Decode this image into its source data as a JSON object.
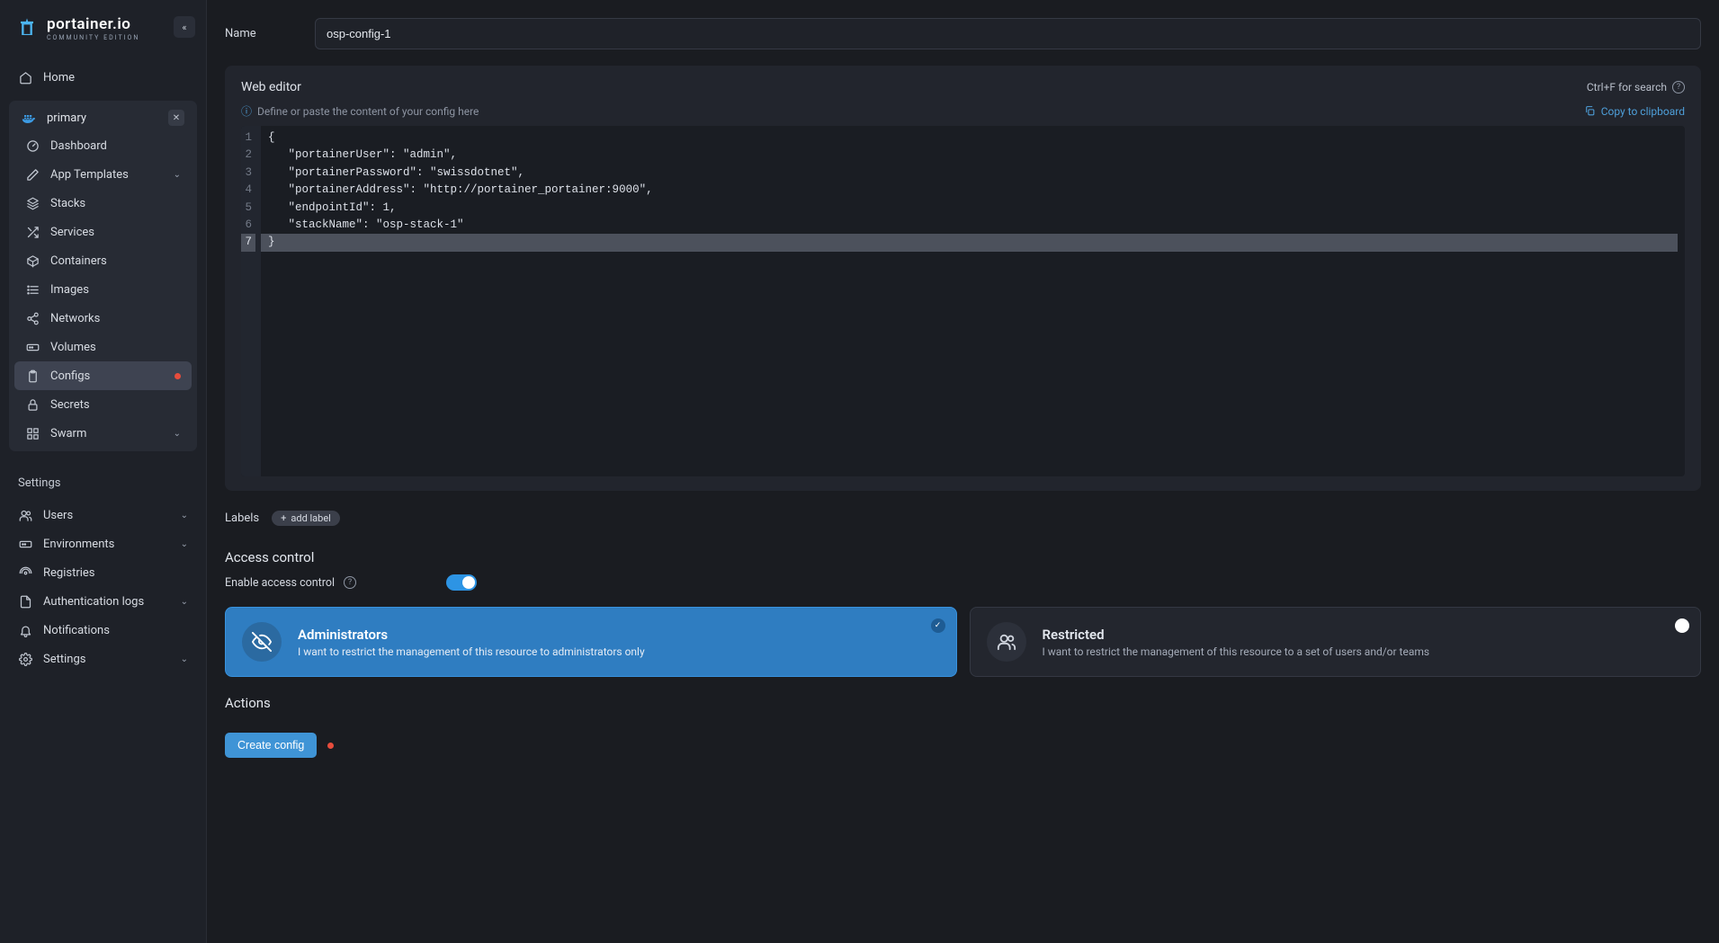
{
  "brand": {
    "name": "portainer.io",
    "edition": "COMMUNITY EDITION"
  },
  "sidebar": {
    "home": "Home",
    "env_name": "primary",
    "items": [
      {
        "label": "Dashboard",
        "icon": "gauge"
      },
      {
        "label": "App Templates",
        "icon": "edit",
        "chevron": true
      },
      {
        "label": "Stacks",
        "icon": "layers"
      },
      {
        "label": "Services",
        "icon": "shuffle"
      },
      {
        "label": "Containers",
        "icon": "box"
      },
      {
        "label": "Images",
        "icon": "list"
      },
      {
        "label": "Networks",
        "icon": "share"
      },
      {
        "label": "Volumes",
        "icon": "hdd"
      },
      {
        "label": "Configs",
        "icon": "clipboard",
        "active": true,
        "dot": true
      },
      {
        "label": "Secrets",
        "icon": "lock"
      },
      {
        "label": "Swarm",
        "icon": "grid3",
        "chevron": true
      }
    ],
    "settings_label": "Settings",
    "settings": [
      {
        "label": "Users",
        "icon": "users",
        "chevron": true
      },
      {
        "label": "Environments",
        "icon": "hdd",
        "chevron": true
      },
      {
        "label": "Registries",
        "icon": "radio"
      },
      {
        "label": "Authentication logs",
        "icon": "file",
        "chevron": true
      },
      {
        "label": "Notifications",
        "icon": "bell"
      },
      {
        "label": "Settings",
        "icon": "gear",
        "chevron": true
      }
    ]
  },
  "form": {
    "name_label": "Name",
    "name_value": "osp-config-1"
  },
  "editor": {
    "title": "Web editor",
    "search_hint": "Ctrl+F for search",
    "hint": "Define or paste the content of your config here",
    "copy": "Copy to clipboard",
    "lines": [
      "{",
      "   \"portainerUser\": \"admin\",",
      "   \"portainerPassword\": \"swissdotnet\",",
      "   \"portainerAddress\": \"http://portainer_portainer:9000\",",
      "   \"endpointId\": 1,",
      "   \"stackName\": \"osp-stack-1\"",
      "}"
    ],
    "current_line_index": 6
  },
  "labels": {
    "label": "Labels",
    "add": "add label"
  },
  "access": {
    "title": "Access control",
    "enable_label": "Enable access control",
    "cards": [
      {
        "title": "Administrators",
        "desc": "I want to restrict the management of this resource to administrators only",
        "selected": true,
        "icon": "eye-off"
      },
      {
        "title": "Restricted",
        "desc": "I want to restrict the management of this resource to a set of users and/or teams",
        "selected": false,
        "icon": "users"
      }
    ]
  },
  "actions": {
    "title": "Actions",
    "create": "Create config"
  }
}
